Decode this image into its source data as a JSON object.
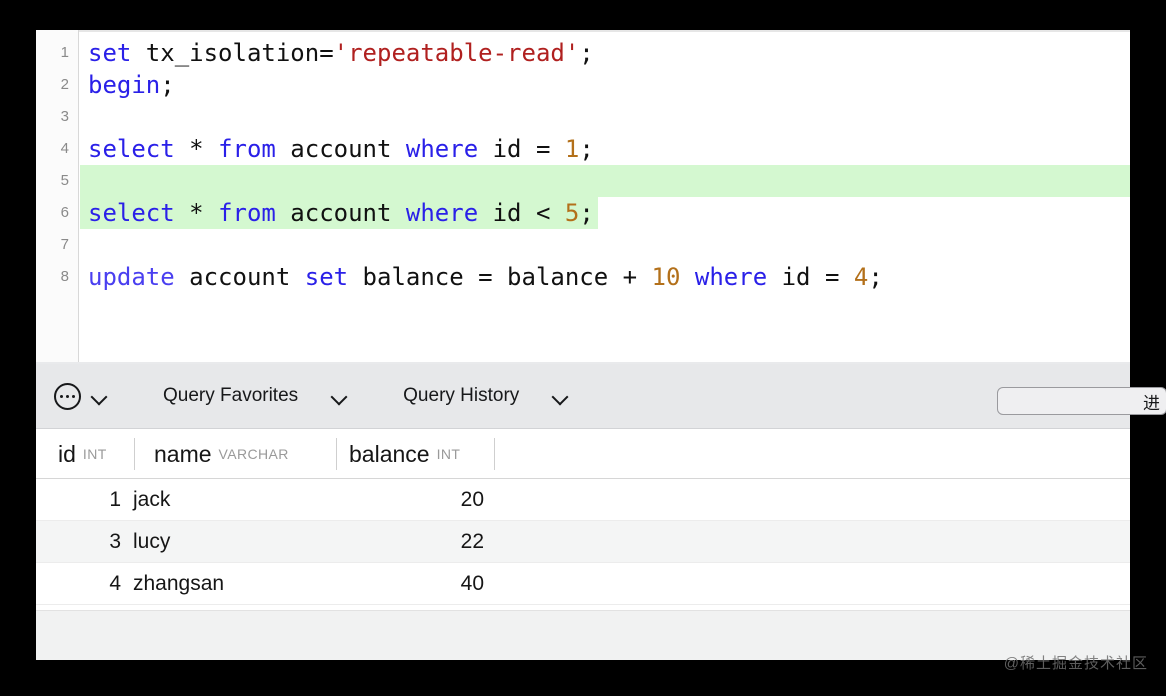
{
  "editor": {
    "lines": [
      {
        "number": "1",
        "highlight": "none",
        "tokens": [
          {
            "t": "set",
            "c": "kw"
          },
          {
            "t": " tx_isolation=",
            "c": "plain"
          },
          {
            "t": "'repeatable-read'",
            "c": "str"
          },
          {
            "t": ";",
            "c": "plain"
          }
        ]
      },
      {
        "number": "2",
        "highlight": "none",
        "tokens": [
          {
            "t": "begin",
            "c": "kw"
          },
          {
            "t": ";",
            "c": "plain"
          }
        ]
      },
      {
        "number": "3",
        "highlight": "none",
        "tokens": []
      },
      {
        "number": "4",
        "highlight": "none",
        "tokens": [
          {
            "t": "select",
            "c": "kw"
          },
          {
            "t": " * ",
            "c": "plain"
          },
          {
            "t": "from",
            "c": "kw"
          },
          {
            "t": " account ",
            "c": "plain"
          },
          {
            "t": "where",
            "c": "kw"
          },
          {
            "t": " id = ",
            "c": "plain"
          },
          {
            "t": "1",
            "c": "num"
          },
          {
            "t": ";",
            "c": "plain"
          }
        ]
      },
      {
        "number": "5",
        "highlight": "full",
        "tokens": []
      },
      {
        "number": "6",
        "highlight": "fit",
        "tokens": [
          {
            "t": "select",
            "c": "kw"
          },
          {
            "t": " * ",
            "c": "plain"
          },
          {
            "t": "from",
            "c": "kw"
          },
          {
            "t": " account ",
            "c": "plain"
          },
          {
            "t": "where",
            "c": "kw"
          },
          {
            "t": " id < ",
            "c": "plain"
          },
          {
            "t": "5",
            "c": "num"
          },
          {
            "t": ";",
            "c": "plain"
          }
        ]
      },
      {
        "number": "7",
        "highlight": "none",
        "tokens": []
      },
      {
        "number": "8",
        "highlight": "none",
        "tokens": [
          {
            "t": "update",
            "c": "kw2"
          },
          {
            "t": " account ",
            "c": "plain"
          },
          {
            "t": "set",
            "c": "kw"
          },
          {
            "t": " balance = balance + ",
            "c": "plain"
          },
          {
            "t": "10",
            "c": "num"
          },
          {
            "t": " ",
            "c": "plain"
          },
          {
            "t": "where",
            "c": "kw"
          },
          {
            "t": " id = ",
            "c": "plain"
          },
          {
            "t": "4",
            "c": "num"
          },
          {
            "t": ";",
            "c": "plain"
          }
        ]
      }
    ]
  },
  "toolbar": {
    "more_icon": "ellipsis-circle-icon",
    "more_chevron": "chevron-down-icon",
    "query_favorites_label": "Query Favorites",
    "query_favorites_chevron": "chevron-down-icon",
    "query_history_label": "Query History",
    "query_history_chevron": "chevron-down-icon",
    "search_value": "进",
    "search_placeholder": ""
  },
  "grid": {
    "columns": [
      {
        "name": "id",
        "type": "INT"
      },
      {
        "name": "name",
        "type": "VARCHAR"
      },
      {
        "name": "balance",
        "type": "INT"
      }
    ],
    "rows": [
      {
        "id": "1",
        "name": "jack",
        "balance": "20"
      },
      {
        "id": "3",
        "name": "lucy",
        "balance": "22"
      },
      {
        "id": "4",
        "name": "zhangsan",
        "balance": "40"
      }
    ]
  },
  "watermark": {
    "text": "@稀土掘金技术社区"
  },
  "colors": {
    "keyword": "#2a20e8",
    "string": "#b0201f",
    "number": "#b3701a",
    "highlight": "#d4f8d0",
    "toolbar_bg": "#e7e8ea"
  }
}
